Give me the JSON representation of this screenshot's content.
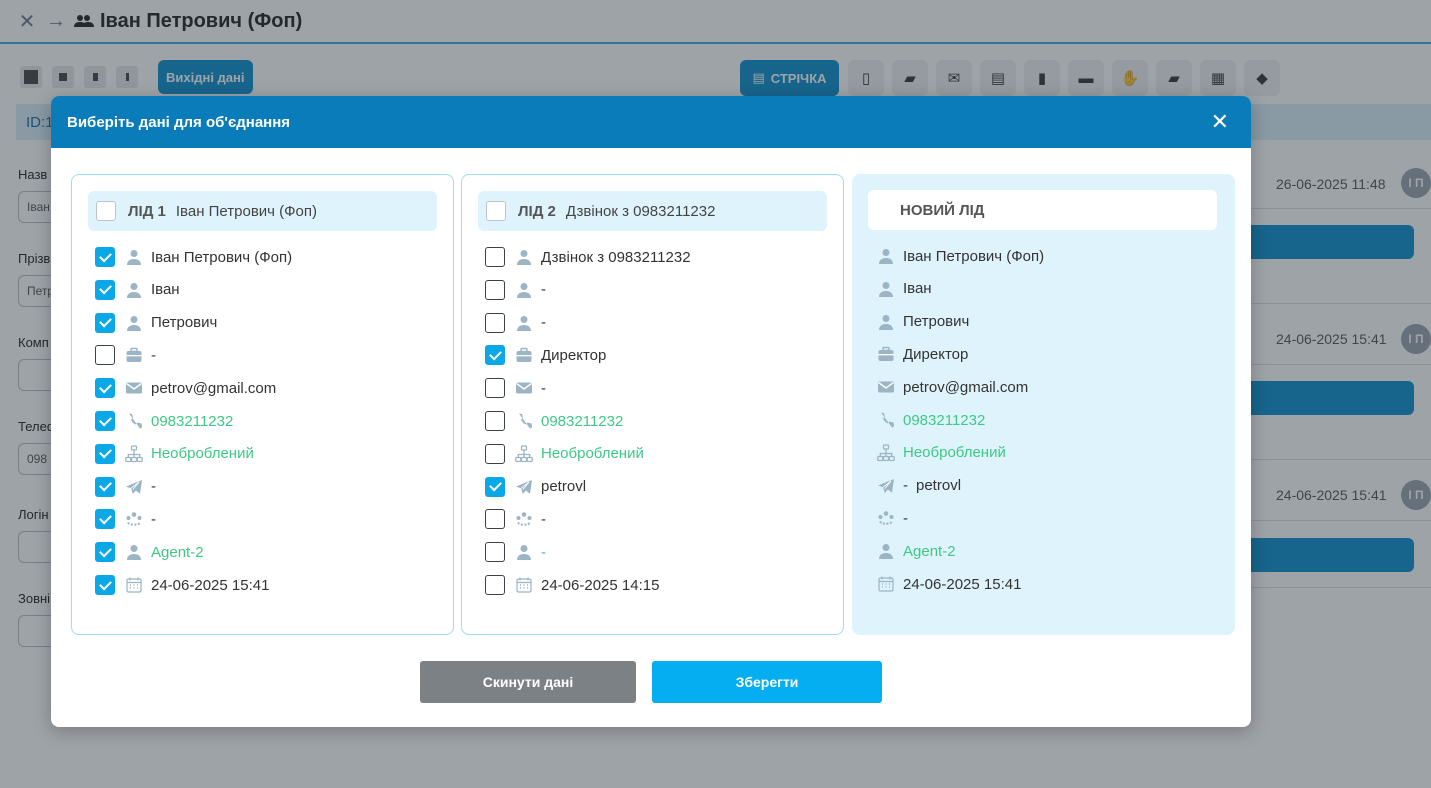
{
  "app": {
    "title": "Іван Петрович (Фоп)",
    "toolbar": {
      "source_button": "Вихідні дані",
      "feed_button": "СТРІЧКА"
    },
    "id_bar": "ID:1",
    "left_fields": [
      {
        "label": "Назв",
        "value": "Іван"
      },
      {
        "label": "Прізв",
        "value": "Петр"
      },
      {
        "label": "Комп",
        "value": ""
      },
      {
        "label": "Телеф",
        "value": "098"
      },
      {
        "label": "Логін",
        "value": ""
      },
      {
        "label": "Зовні",
        "value": ""
      }
    ],
    "feed": [
      {
        "date": "26-06-2025 11:48",
        "avatar": "І П"
      },
      {
        "date": "24-06-2025 15:41",
        "avatar": "І П"
      },
      {
        "date": "24-06-2025 15:41",
        "avatar": "І П"
      }
    ]
  },
  "modal": {
    "title": "Виберіть дані для об'єднання",
    "columns": [
      {
        "name": "ЛІД 1",
        "subtitle": "Іван Петрович (Фоп)",
        "rows": [
          {
            "icon": "person-icon",
            "value": "Іван Петрович (Фоп)",
            "checked": true,
            "green": false
          },
          {
            "icon": "person-icon",
            "value": "Іван",
            "checked": true,
            "green": false
          },
          {
            "icon": "person-icon",
            "value": "Петрович",
            "checked": true,
            "green": false
          },
          {
            "icon": "briefcase-icon",
            "value": "-",
            "checked": false,
            "green": false
          },
          {
            "icon": "envelope-icon",
            "value": "petrov@gmail.com",
            "checked": true,
            "green": false
          },
          {
            "icon": "phone-icon",
            "value": "0983211232",
            "checked": true,
            "green": true
          },
          {
            "icon": "hierarchy-icon",
            "value": "Необроблений",
            "checked": true,
            "green": true
          },
          {
            "icon": "telegram-icon",
            "value": "-",
            "checked": true,
            "green": false
          },
          {
            "icon": "group-icon",
            "value": "-",
            "checked": true,
            "green": false
          },
          {
            "icon": "person-icon",
            "value": "Agent-2",
            "checked": true,
            "green": true
          },
          {
            "icon": "calendar-icon",
            "value": "24-06-2025 15:41",
            "checked": true,
            "green": false
          }
        ]
      },
      {
        "name": "ЛІД 2",
        "subtitle": "Дзвінок з 0983211232",
        "rows": [
          {
            "icon": "person-icon",
            "value": "Дзвінок з 0983211232",
            "checked": false,
            "green": false
          },
          {
            "icon": "person-icon",
            "value": "-",
            "checked": false,
            "green": false
          },
          {
            "icon": "person-icon",
            "value": "-",
            "checked": false,
            "green": false
          },
          {
            "icon": "briefcase-icon",
            "value": "Директор",
            "checked": true,
            "green": false
          },
          {
            "icon": "envelope-icon",
            "value": "-",
            "checked": false,
            "green": false
          },
          {
            "icon": "phone-icon",
            "value": "0983211232",
            "checked": false,
            "green": true
          },
          {
            "icon": "hierarchy-icon",
            "value": "Необроблений",
            "checked": false,
            "green": true
          },
          {
            "icon": "telegram-icon",
            "value": "petrovl",
            "checked": true,
            "green": false
          },
          {
            "icon": "group-icon",
            "value": "-",
            "checked": false,
            "green": false
          },
          {
            "icon": "person-icon",
            "value": "-",
            "checked": false,
            "green": true
          },
          {
            "icon": "calendar-icon",
            "value": "24-06-2025 14:15",
            "checked": false,
            "green": false
          }
        ]
      },
      {
        "name": "НОВИЙ ЛІД",
        "subtitle": "",
        "rows": [
          {
            "icon": "person-icon",
            "value": "Іван Петрович (Фоп)",
            "green": false
          },
          {
            "icon": "person-icon",
            "value": "Іван",
            "green": false
          },
          {
            "icon": "person-icon",
            "value": "Петрович",
            "green": false
          },
          {
            "icon": "briefcase-icon",
            "value": "Директор",
            "green": false
          },
          {
            "icon": "envelope-icon",
            "value": "petrov@gmail.com",
            "green": false
          },
          {
            "icon": "phone-icon",
            "value": "0983211232",
            "green": true
          },
          {
            "icon": "hierarchy-icon",
            "value": "Необроблений",
            "green": true
          },
          {
            "icon": "telegram-icon",
            "value": "-",
            "extra": "petrovl",
            "green": false
          },
          {
            "icon": "group-icon",
            "value": "-",
            "green": false
          },
          {
            "icon": "person-icon",
            "value": "Agent-2",
            "green": true
          },
          {
            "icon": "calendar-icon",
            "value": "24-06-2025 15:41",
            "green": false
          }
        ]
      }
    ],
    "buttons": {
      "reset": "Скинути дані",
      "save": "Зберегти"
    },
    "colors": {
      "header": "#0a7cba",
      "checkbox_on": "#0aa8e6",
      "green_text": "#3dc985",
      "icon": "#9bb5c4",
      "reset": "#7c8186",
      "save": "#05aef0"
    }
  }
}
